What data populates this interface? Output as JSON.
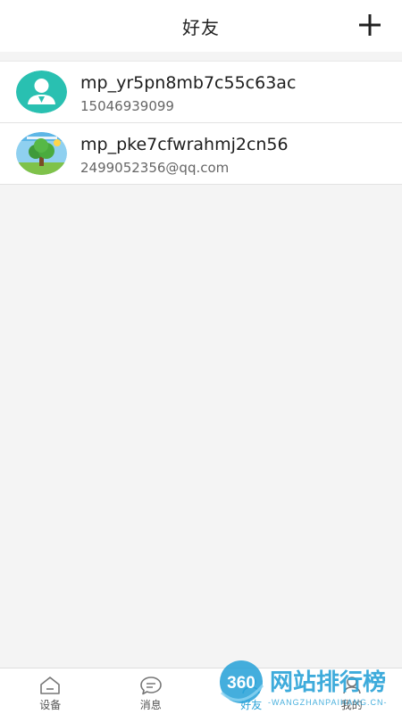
{
  "header": {
    "title": "好友",
    "add_icon": "plus-icon"
  },
  "friends": [
    {
      "name": "mp_yr5pn8mb7c55c63ac",
      "subtitle": "15046939099",
      "avatar": "default-user-avatar"
    },
    {
      "name": "mp_pke7cfwrahmj2cn56",
      "subtitle": "2499052356@qq.com",
      "avatar": "tree-photo-avatar"
    }
  ],
  "nav": {
    "items": [
      {
        "label": "设备",
        "icon": "home-icon",
        "active": false
      },
      {
        "label": "消息",
        "icon": "message-icon",
        "active": false
      },
      {
        "label": "好友",
        "icon": "friends-icon",
        "active": true
      },
      {
        "label": "我的",
        "icon": "profile-icon",
        "active": false
      }
    ]
  },
  "watermark": {
    "brand_number": "360",
    "brand_text": "网站排行榜",
    "url_text": "-WANGZHANPAIHANG.CN-"
  },
  "colors": {
    "accent": "#2aa3d8",
    "avatar_teal": "#29c0b1",
    "background": "#f4f4f4"
  }
}
